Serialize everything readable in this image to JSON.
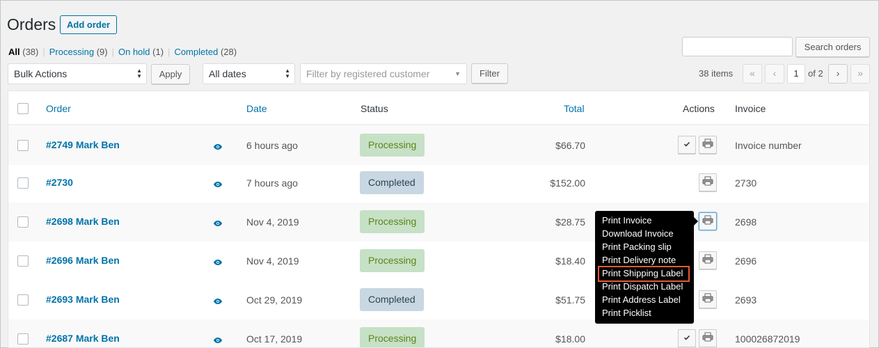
{
  "page": {
    "title": "Orders",
    "add_button": "Add order"
  },
  "views": [
    {
      "label": "All",
      "count": "(38)"
    },
    {
      "label": "Processing",
      "count": "(9)"
    },
    {
      "label": "On hold",
      "count": "(1)"
    },
    {
      "label": "Completed",
      "count": "(28)"
    }
  ],
  "search": {
    "value": "",
    "button": "Search orders"
  },
  "filters": {
    "bulk_actions": "Bulk Actions",
    "apply": "Apply",
    "dates": "All dates",
    "customer_placeholder": "Filter by registered customer",
    "filter_button": "Filter"
  },
  "pagination": {
    "items": "38 items",
    "first": "«",
    "prev": "‹",
    "current_page": "1",
    "of_pages": "of 2",
    "next": "›",
    "last": "»"
  },
  "columns": {
    "order": "Order",
    "date": "Date",
    "status": "Status",
    "total": "Total",
    "actions": "Actions",
    "invoice": "Invoice"
  },
  "rows": [
    {
      "order": "#2749 Mark Ben",
      "date": "6 hours ago",
      "status": "Processing",
      "total": "$66.70",
      "invoice": "Invoice number"
    },
    {
      "order": "#2730",
      "date": "7 hours ago",
      "status": "Completed",
      "total": "$152.00",
      "invoice": "2730"
    },
    {
      "order": "#2698 Mark Ben",
      "date": "Nov 4, 2019",
      "status": "Processing",
      "total": "$28.75",
      "invoice": "2698"
    },
    {
      "order": "#2696 Mark Ben",
      "date": "Nov 4, 2019",
      "status": "Processing",
      "total": "$18.40",
      "invoice": "2696"
    },
    {
      "order": "#2693 Mark Ben",
      "date": "Oct 29, 2019",
      "status": "Completed",
      "total": "$51.75",
      "invoice": "2693"
    },
    {
      "order": "#2687 Mark Ben",
      "date": "Oct 17, 2019",
      "status": "Processing",
      "total": "$18.00",
      "invoice": "100026872019"
    }
  ],
  "print_menu": [
    "Print Invoice",
    "Download Invoice",
    "Print Packing slip",
    "Print Delivery note",
    "Print Shipping Label",
    "Print Dispatch Label",
    "Print Address Label",
    "Print Picklist"
  ],
  "icons": {
    "view": "eye-icon",
    "complete": "checkmark-icon",
    "print": "printer-icon",
    "select_arrows": "updown-arrows-icon"
  },
  "colors": {
    "link": "#0073aa",
    "processing_bg": "#c6e1c6",
    "processing_text": "#5b841b",
    "completed_bg": "#c8d7e1",
    "completed_text": "#2e4453",
    "highlight_border": "#e35b32"
  }
}
